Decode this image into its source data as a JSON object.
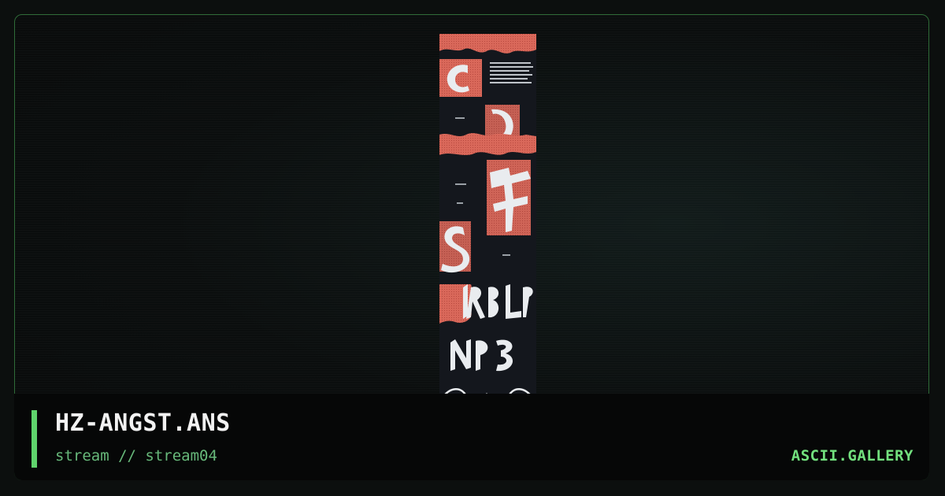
{
  "artwork": {
    "name": "ansi-artwork-preview",
    "accent_color": "#d9685a",
    "ink_color": "#e9ecef",
    "background_color": "#14171d",
    "tiny_texts": [
      "angst",
      "the rise",
      "fade",
      "away"
    ]
  },
  "footer": {
    "title": "HZ-ANGST.ANS",
    "subtitle": "stream // stream04",
    "brand": "ASCII.GALLERY",
    "accent_color": "#5fd46c"
  }
}
